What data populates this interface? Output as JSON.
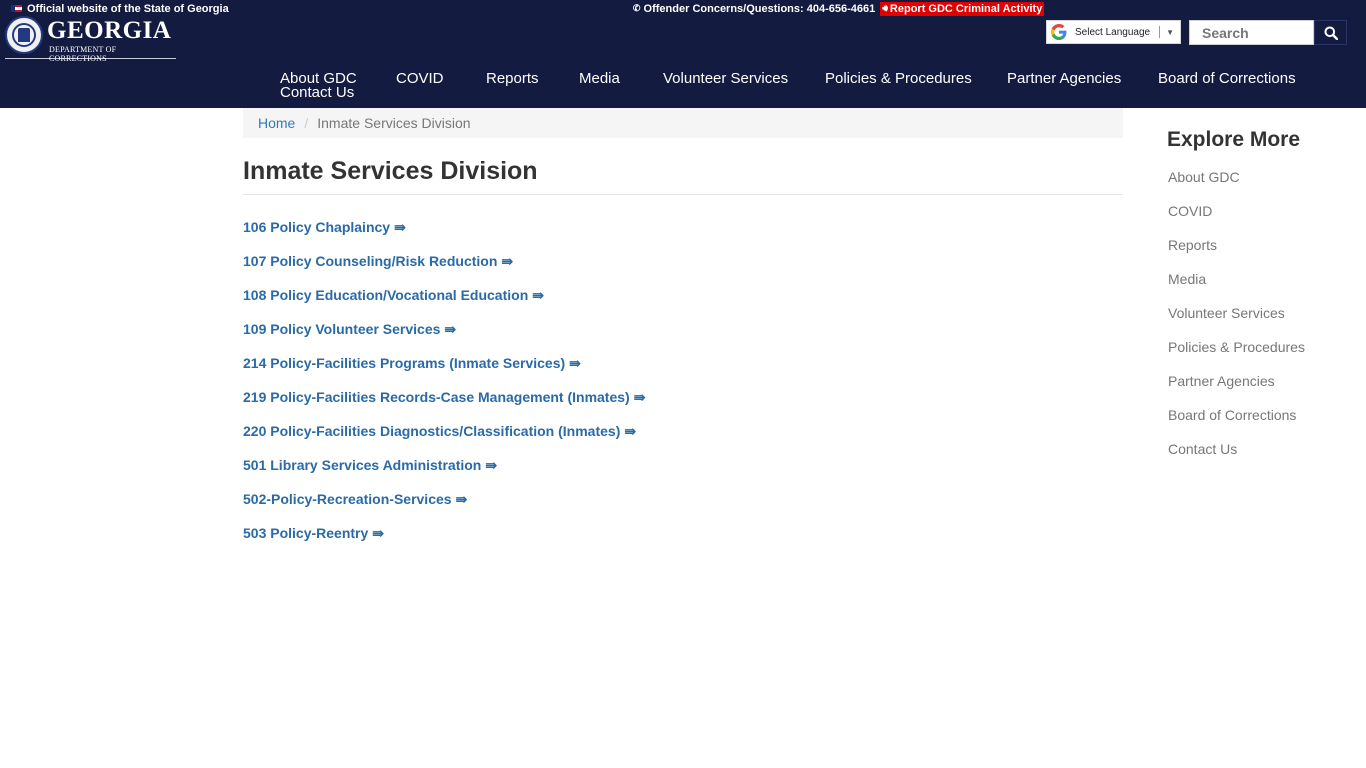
{
  "topbar": {
    "official_text": "Official website of the State of Georgia",
    "concerns_text": "Offender Concerns/Questions: 404-656-4661",
    "report_button": "Report GDC Criminal Activity"
  },
  "logo": {
    "title": "GEORGIA",
    "subtitle": "DEPARTMENT OF CORRECTIONS"
  },
  "language": {
    "label": "Select Language",
    "arrow": "▼"
  },
  "search": {
    "placeholder": "Search"
  },
  "nav": {
    "items": [
      {
        "label": "About GDC"
      },
      {
        "label": "COVID"
      },
      {
        "label": "Reports"
      },
      {
        "label": "Media"
      },
      {
        "label": "Volunteer Services"
      },
      {
        "label": "Policies & Procedures"
      },
      {
        "label": "Partner Agencies"
      },
      {
        "label": "Board of Corrections"
      },
      {
        "label": "Contact Us"
      }
    ]
  },
  "breadcrumb": {
    "home": "Home",
    "separator": "/",
    "current": "Inmate Services Division"
  },
  "main": {
    "title": "Inmate Services Division",
    "arrow": "⇛",
    "documents": [
      {
        "label": "106 Policy Chaplaincy"
      },
      {
        "label": "107 Policy Counseling/Risk Reduction"
      },
      {
        "label": "108 Policy Education/Vocational Education"
      },
      {
        "label": "109 Policy Volunteer Services"
      },
      {
        "label": "214 Policy-Facilities Programs (Inmate Services)"
      },
      {
        "label": "219 Policy-Facilities Records-Case Management (Inmates)"
      },
      {
        "label": "220 Policy-Facilities Diagnostics/Classification (Inmates)"
      },
      {
        "label": "501 Library Services Administration"
      },
      {
        "label": "502-Policy-Recreation-Services"
      },
      {
        "label": "503 Policy-Reentry"
      }
    ]
  },
  "sidebar": {
    "title": "Explore More",
    "items": [
      {
        "label": "About GDC"
      },
      {
        "label": "COVID"
      },
      {
        "label": "Reports"
      },
      {
        "label": "Media"
      },
      {
        "label": "Volunteer Services"
      },
      {
        "label": "Policies & Procedures"
      },
      {
        "label": "Partner Agencies"
      },
      {
        "label": "Board of Corrections"
      },
      {
        "label": "Contact Us"
      }
    ]
  },
  "icons": {
    "flag": "georgia-flag-icon",
    "phone": "phone-icon",
    "speaker": "speaker-icon",
    "google": "google-g-icon",
    "search": "search-icon"
  },
  "colors": {
    "header_bg": "#141b40",
    "report_bg": "#e00000",
    "link": "#2a6aa6",
    "sidebar_link": "#777777"
  }
}
